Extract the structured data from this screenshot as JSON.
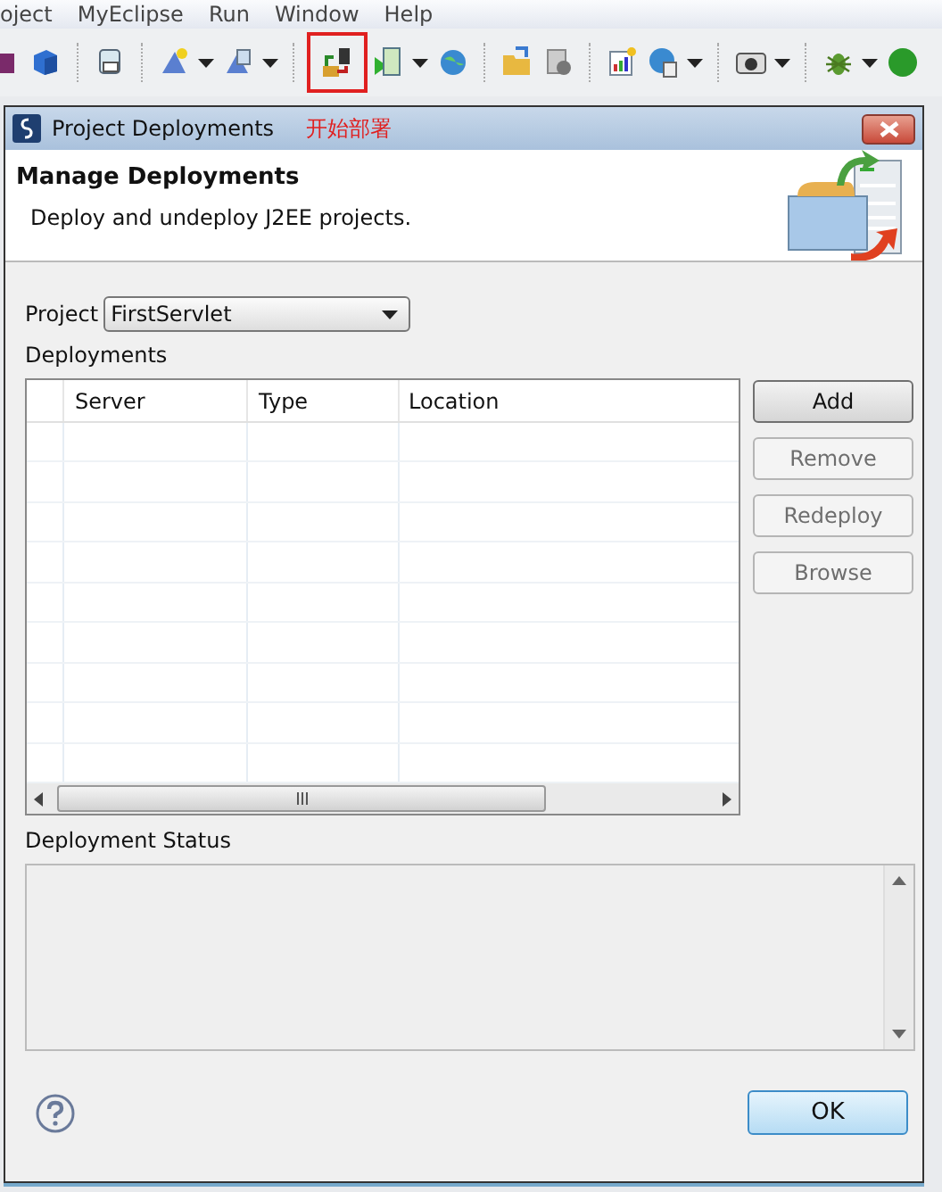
{
  "menu_bar": {
    "items": [
      "oject",
      "MyEclipse",
      "Run",
      "Window",
      "Help"
    ]
  },
  "toolbar": {
    "groups": [
      [
        {
          "has_menu": false,
          "highlighted": false
        },
        {
          "has_menu": false,
          "highlighted": false
        }
      ],
      [
        {
          "has_menu": false,
          "highlighted": false
        }
      ],
      [
        {
          "has_menu": true,
          "highlighted": false
        },
        {
          "has_menu": true,
          "highlighted": false
        }
      ],
      [
        {
          "has_menu": false,
          "highlighted": true
        },
        {
          "has_menu": true,
          "highlighted": false
        },
        {
          "has_menu": false,
          "highlighted": false
        }
      ],
      [
        {
          "has_menu": false,
          "highlighted": false
        },
        {
          "has_menu": false,
          "highlighted": false
        }
      ],
      [
        {
          "has_menu": false,
          "highlighted": false
        },
        {
          "has_menu": true,
          "highlighted": false
        }
      ],
      [
        {
          "has_menu": true,
          "highlighted": false
        }
      ],
      [
        {
          "has_menu": true,
          "highlighted": false
        },
        {
          "has_menu": false,
          "highlighted": false
        }
      ]
    ]
  },
  "dialog": {
    "title": "Project Deployments",
    "annotation": "开始部署",
    "header": {
      "title": "Manage Deployments",
      "description": "Deploy and undeploy J2EE projects."
    },
    "project": {
      "label": "Project",
      "value": "FirstServlet"
    },
    "deployments": {
      "label": "Deployments",
      "columns": [
        "Server",
        "Type",
        "Location"
      ]
    },
    "buttons": [
      {
        "label": "Add",
        "disabled": false
      },
      {
        "label": "Remove",
        "disabled": true
      },
      {
        "label": "Redeploy",
        "disabled": true
      },
      {
        "label": "Browse",
        "disabled": true
      }
    ],
    "status": {
      "label": "Deployment Status"
    },
    "ok_button": {
      "label": "OK"
    }
  }
}
